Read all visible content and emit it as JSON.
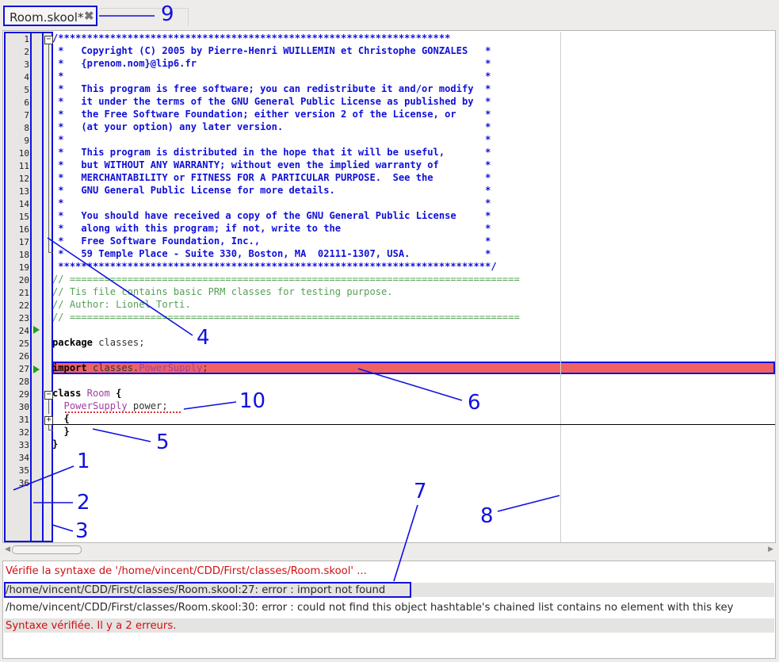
{
  "tab": {
    "title": "Room.skool*",
    "close_icon": "close-icon"
  },
  "line_numbers": [
    "1",
    "2",
    "3",
    "4",
    "5",
    "6",
    "7",
    "8",
    "9",
    "10",
    "11",
    "12",
    "13",
    "14",
    "15",
    "16",
    "17",
    "18",
    "19",
    "20",
    "21",
    "22",
    "23",
    "24",
    "25",
    "26",
    "27",
    "28",
    "29",
    "30",
    "31",
    "32",
    "33",
    "34",
    "35",
    "36"
  ],
  "code": {
    "l1": "/********************************************************************",
    "l2": " *   Copyright (C) 2005 by Pierre-Henri WUILLEMIN et Christophe GONZALES   *",
    "l3": " *   {prenom.nom}@lip6.fr                                                  *",
    "l4": " *                                                                         *",
    "l5": " *   This program is free software; you can redistribute it and/or modify  *",
    "l6": " *   it under the terms of the GNU General Public License as published by  *",
    "l7": " *   the Free Software Foundation; either version 2 of the License, or     *",
    "l8": " *   (at your option) any later version.                                   *",
    "l9": " *                                                                         *",
    "l10": " *   This program is distributed in the hope that it will be useful,       *",
    "l11": " *   but WITHOUT ANY WARRANTY; without even the implied warranty of        *",
    "l12": " *   MERCHANTABILITY or FITNESS FOR A PARTICULAR PURPOSE.  See the         *",
    "l13": " *   GNU General Public License for more details.                          *",
    "l14": " *                                                                         *",
    "l15": " *   You should have received a copy of the GNU General Public License     *",
    "l16": " *   along with this program; if not, write to the                         *",
    "l17": " *   Free Software Foundation, Inc.,                                       *",
    "l18": " *   59 Temple Place - Suite 330, Boston, MA  02111-1307, USA.             *",
    "l19": " ***************************************************************************/",
    "l20": "// ==============================================================================",
    "l21": "// Tis file contains basic PRM classes for testing purpose.",
    "l22": "// Author: Lionel Torti.",
    "l23": "// ==============================================================================",
    "l25_kw": "package",
    "l25_rest": " classes;",
    "l27_kw": "import",
    "l27_pkg": " classes.",
    "l27_cls": "PowerSupply",
    "l27_end": ";",
    "l29_kw": "class",
    "l29_name": " Room",
    "l29_brace": " {",
    "l30_type": "  PowerSupply",
    "l30_rest": " power;",
    "l31": "  {",
    "l33": "  }",
    "l34": "}"
  },
  "console": {
    "line1": "Vérifie la syntaxe de '/home/vincent/CDD/First/classes/Room.skool' ...",
    "line2": "/home/vincent/CDD/First/classes/Room.skool:27: error : import not found",
    "line3": "/home/vincent/CDD/First/classes/Room.skool:30: error : could not find this object hashtable's chained list contains no element with this key",
    "line4": "Syntaxe vérifiée. Il y a 2 erreurs."
  },
  "callouts": {
    "c1": "1",
    "c2": "2",
    "c3": "3",
    "c4": "4",
    "c5": "5",
    "c6": "6",
    "c7": "7",
    "c8": "8",
    "c9": "9",
    "c10": "10"
  },
  "colors": {
    "callout": "#1010e0",
    "error_line": "#f06262",
    "comment_header": "#1010d8",
    "comment": "#55a055",
    "error_text": "#d01010"
  }
}
